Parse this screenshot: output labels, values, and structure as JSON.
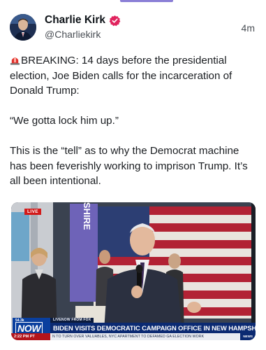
{
  "post": {
    "author_name": "Charlie Kirk",
    "handle": "@Charliekirk",
    "timestamp": "4m",
    "verified": true,
    "body": {
      "para1": "BREAKING: 14 days before the presidential election, Joe Biden calls for the incarceration of Donald Trump:",
      "para2": "“We gotta lock him up.”",
      "para3": "This is the “tell” as to why the Democrat machine has been feverishly working to imprison Trump. It’s all been intentional."
    },
    "icons": {
      "siren": "police-siren-emoji",
      "verified": "verified-badge-icon"
    }
  },
  "video": {
    "live_badge": "LIVE",
    "sign_text": "MPSHIRE",
    "viewers": "54.3k",
    "livenow_tag": "LIVENOW FROM FOX",
    "now_label": "NOW",
    "headline": "BIDEN VISITS DEMOCRATIC CAMPAIGN OFFICE IN NEW HAMPSHIRE",
    "ticker_time": "2:22 PM PT",
    "ticker_text": "N TO TURN OVER VALUABLES, NYC APARTMENT TO DEFAMED GA ELECTION WORK",
    "ticker_logo": "NEWS"
  },
  "colors": {
    "accent": "#8b7fd6",
    "verified": "#e0245e",
    "chyron_blue": "#0b2a72",
    "ticker_red": "#b3141b"
  }
}
